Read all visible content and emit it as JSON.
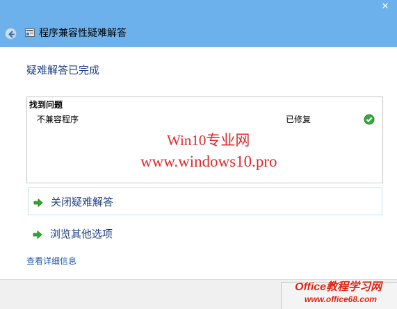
{
  "window": {
    "close_glyph": "✕",
    "title": "程序兼容性疑难解答"
  },
  "heading": "疑难解答已完成",
  "results": {
    "header": "找到问题",
    "items": [
      {
        "name": "不兼容程序",
        "status": "已修复",
        "status_icon": "green-check-icon"
      }
    ]
  },
  "options": [
    {
      "label": "关闭疑难解答",
      "icon": "green-arrow-icon"
    },
    {
      "label": "浏览其他选项",
      "icon": "green-arrow-icon"
    }
  ],
  "details_link": "查看详细信息",
  "watermark": {
    "line1": "Win10专业网",
    "line2": "www.windows10.pro"
  },
  "footer_logo": {
    "main": "Office教程学习网",
    "url": "www.office68.com"
  },
  "colors": {
    "titlebar": "#6cb1ec",
    "heading": "#1e3f85",
    "link": "#1e5aa8",
    "watermark": "#e02828",
    "check": "#3aa83a",
    "arrow": "#2fa82f"
  }
}
